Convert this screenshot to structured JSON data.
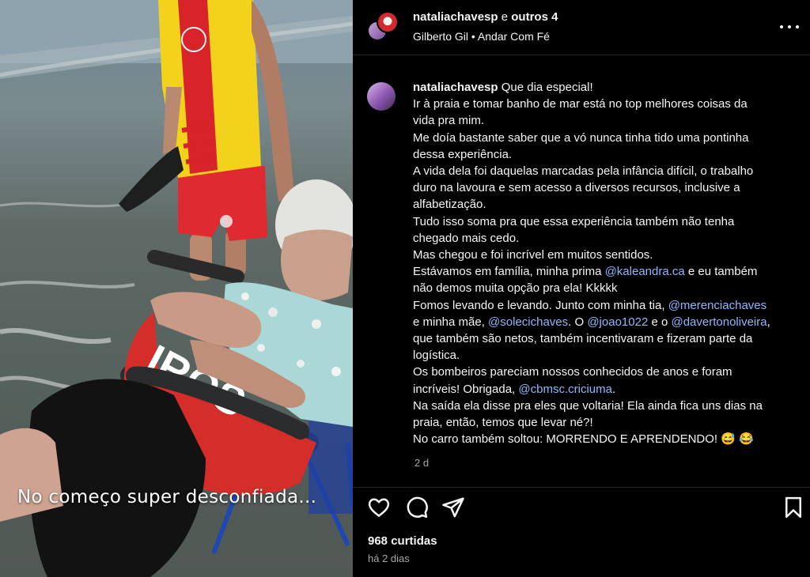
{
  "media": {
    "caption": "No começo super desconfiada..."
  },
  "header": {
    "username": "nataliachavesp",
    "collab_sep": "e",
    "collab_others": "outros 4",
    "music": "Gilberto Gil • Andar Com Fé"
  },
  "post": {
    "username": "nataliachavesp",
    "lines": [
      [
        {
          "t": "Que dia especial!"
        }
      ],
      [
        {
          "t": "Ir à praia e tomar banho de mar está no top melhores coisas da"
        }
      ],
      [
        {
          "t": "vida pra mim."
        }
      ],
      [
        {
          "t": "Me doía bastante saber que a vó nunca tinha tido uma pontinha"
        }
      ],
      [
        {
          "t": "dessa experiência."
        }
      ],
      [
        {
          "t": "A vida dela foi daquelas marcadas pela infância difícil, o trabalho"
        }
      ],
      [
        {
          "t": "duro na lavoura e sem acesso a diversos recursos, inclusive a"
        }
      ],
      [
        {
          "t": "alfabetização."
        }
      ],
      [
        {
          "t": "Tudo isso soma pra que essa experiência também não tenha"
        }
      ],
      [
        {
          "t": "chegado mais cedo."
        }
      ],
      [
        {
          "t": "Mas chegou e foi incrível em muitos sentidos."
        }
      ],
      [
        {
          "t": "Estávamos em família, minha prima "
        },
        {
          "m": "@kaleandra.ca"
        },
        {
          "t": " e eu também"
        }
      ],
      [
        {
          "t": "não demos muita opção pra ela! Kkkkk"
        }
      ],
      [
        {
          "t": "Fomos levando e levando. Junto com minha tia, "
        },
        {
          "m": "@merenciachaves"
        }
      ],
      [
        {
          "t": "e minha mãe, "
        },
        {
          "m": "@solecichaves"
        },
        {
          "t": ". O "
        },
        {
          "m": "@joao1022"
        },
        {
          "t": " e o "
        },
        {
          "m": "@davertonoliveira"
        },
        {
          "t": ","
        }
      ],
      [
        {
          "t": "que também são netos, também incentivaram e fizeram parte da"
        }
      ],
      [
        {
          "t": "logística."
        }
      ],
      [
        {
          "t": "Os bombeiros pareciam nossos conhecidos de anos e foram"
        }
      ],
      [
        {
          "t": "incríveis! Obrigada, "
        },
        {
          "m": "@cbmsc.criciuma"
        },
        {
          "t": "."
        }
      ],
      [
        {
          "t": "Na saída ela disse pra eles que voltaria! Ela ainda fica uns dias na"
        }
      ],
      [
        {
          "t": "praia, então, temos que levar né?!"
        }
      ],
      [
        {
          "t": "No carro também soltou: MORRENDO E APRENDENDO! 😅 😂"
        }
      ]
    ],
    "time_short": "2 d"
  },
  "actions": {
    "like_icon": "heart-icon",
    "comment_icon": "comment-icon",
    "share_icon": "send-icon",
    "save_icon": "bookmark-icon"
  },
  "likes": "968 curtidas",
  "posted_ago": "há 2 dias",
  "colors": {
    "background": "#000000",
    "text": "#f5f5f5",
    "muted": "#a8a8a8",
    "mention": "#8fb7ff",
    "lifeguard_yellow": "#f2d21b",
    "lifeguard_red": "#d8232a"
  }
}
